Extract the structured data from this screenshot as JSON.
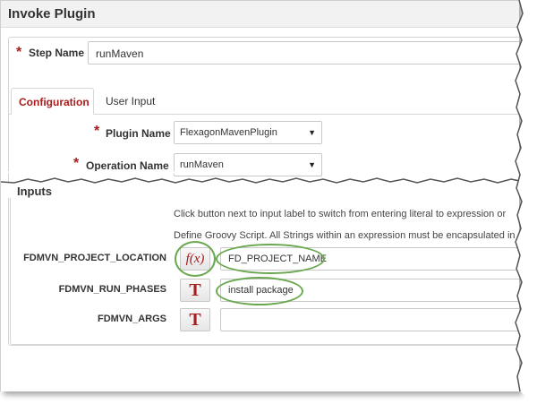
{
  "window": {
    "title": "Invoke Plugin"
  },
  "step": {
    "label": "Step Name",
    "value": "runMaven",
    "required_mark": "*"
  },
  "tabs": [
    {
      "label": "Configuration",
      "active": true
    },
    {
      "label": "User Input",
      "active": false
    }
  ],
  "plugin": {
    "label": "Plugin Name",
    "value": "FlexagonMavenPlugin",
    "required_mark": "*"
  },
  "operation": {
    "label": "Operation Name",
    "value": "runMaven",
    "required_mark": "*"
  },
  "inputs": {
    "title": "Inputs",
    "help_line1": "Click button next to input label to switch from entering literal to expression or",
    "help_line2": "Define Groovy Script. All Strings within an expression must be encapsulated in",
    "rows": [
      {
        "label": "FDMVN_PROJECT_LOCATION",
        "button": "f(x)",
        "value": "FD_PROJECT_NAME"
      },
      {
        "label": "FDMVN_RUN_PHASES",
        "button": "T",
        "value": "install package"
      },
      {
        "label": "FDMVN_ARGS",
        "button": "T",
        "value": ""
      }
    ]
  },
  "colors": {
    "accent": "#a61d1d",
    "highlight": "#6aa84f"
  }
}
